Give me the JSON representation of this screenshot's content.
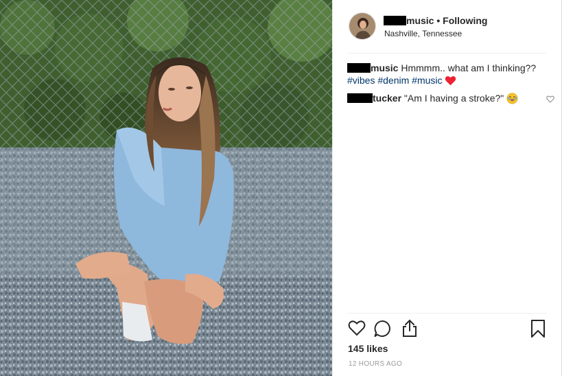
{
  "post": {
    "username_suffix": "music",
    "follow_label": " • Following",
    "location": "Nashville, Tennessee",
    "likes": "145 likes",
    "timestamp": "12 HOURS AGO"
  },
  "caption": {
    "username_suffix": "music",
    "text": " Hmmmm.. what am I thinking??",
    "tags": [
      "#vibes",
      "#denim",
      "#music"
    ]
  },
  "comment": {
    "username_suffix": "tucker",
    "text": " \"Am I having a stroke?\" "
  },
  "icons": {
    "like": "heart-outline-icon",
    "comment": "speech-bubble-icon",
    "share": "share-arrow-icon",
    "save": "bookmark-icon"
  },
  "colors": {
    "hashtag": "#003569",
    "text": "#262626",
    "muted": "#999999",
    "heart": "#ed2233"
  }
}
